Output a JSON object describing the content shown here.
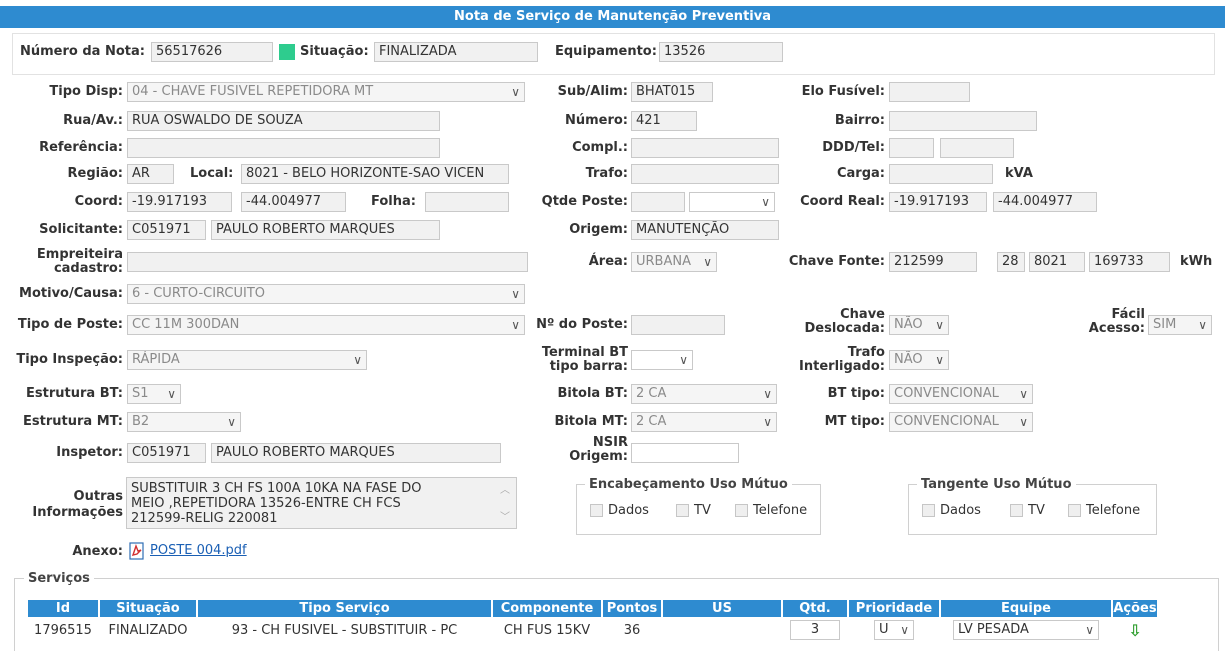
{
  "title": "Nota de Serviço de Manutenção Preventiva",
  "header": {
    "numero_label": "Número da Nota:",
    "numero_value": "56517626",
    "situacao_label": "Situação:",
    "situacao_value": "FINALIZADA",
    "status_color": "#2ecc8e",
    "equip_label": "Equipamento:",
    "equip_value": "13526"
  },
  "form": {
    "tipo_disp_label": "Tipo Disp:",
    "tipo_disp_value": "04 - CHAVE FUSIVEL REPETIDORA MT",
    "sub_alim_label": "Sub/Alim:",
    "sub_alim_value": "BHAT015",
    "elo_label": "Elo Fusível:",
    "elo_value": "",
    "rua_label": "Rua/Av.:",
    "rua_value": "RUA OSWALDO DE SOUZA",
    "numero_label": "Número:",
    "numero_value": "421",
    "bairro_label": "Bairro:",
    "bairro_value": "",
    "referencia_label": "Referência:",
    "referencia_value": "",
    "compl_label": "Compl.:",
    "compl_value": "",
    "ddd_label": "DDD/Tel:",
    "ddd_value": "",
    "tel_value": "",
    "regiao_label": "Região:",
    "regiao_value": "AR",
    "local_label": "Local:",
    "local_value": "8021 - BELO HORIZONTE-SAO VICEN",
    "trafo_label": "Trafo:",
    "trafo_value": "",
    "carga_label": "Carga:",
    "carga_value": "",
    "carga_unit": "kVA",
    "coord_label": "Coord:",
    "coord_lat": "-19.917193",
    "coord_lon": "-44.004977",
    "folha_label": "Folha:",
    "folha_value": "",
    "qtde_poste_label": "Qtde Poste:",
    "qtde_poste_value": "",
    "qtde_poste_select": "",
    "coord_real_label": "Coord Real:",
    "coord_real_lat": "-19.917193",
    "coord_real_lon": "-44.004977",
    "solicitante_label": "Solicitante:",
    "solicitante_code": "C051971",
    "solicitante_name": "PAULO ROBERTO MARQUES",
    "origem_label": "Origem:",
    "origem_value": "MANUTENÇÃO",
    "empreiteira_label_1": "Empreiteira",
    "empreiteira_label_2": "cadastro:",
    "empreiteira_value": "",
    "area_label": "Área:",
    "area_value": "URBANA",
    "chave_fonte_label": "Chave Fonte:",
    "chave_fonte_1": "212599",
    "chave_fonte_2": "28",
    "chave_fonte_3": "8021",
    "chave_fonte_4": "169733",
    "kwh_unit": "kWh",
    "motivo_label": "Motivo/Causa:",
    "motivo_value": "6 - CURTO-CIRCUITO",
    "tipo_poste_label": "Tipo de Poste:",
    "tipo_poste_value": "CC 11M 300DAN",
    "n_poste_label": "Nº do Poste:",
    "n_poste_value": "",
    "chave_desl_label_1": "Chave",
    "chave_desl_label_2": "Deslocada:",
    "chave_desl_value": "NÃO",
    "facil_label_1": "Fácil",
    "facil_label_2": "Acesso:",
    "facil_value": "SIM",
    "tipo_insp_label": "Tipo Inspeção:",
    "tipo_insp_value": "RÁPIDA",
    "terminal_label_1": "Terminal BT",
    "terminal_label_2": "tipo barra:",
    "terminal_value": "",
    "trafo_int_label_1": "Trafo",
    "trafo_int_label_2": "Interligado:",
    "trafo_int_value": "NÃO",
    "estrutura_bt_label": "Estrutura BT:",
    "estrutura_bt_value": "S1",
    "bitola_bt_label": "Bitola BT:",
    "bitola_bt_value": "2 CA",
    "bt_tipo_label": "BT tipo:",
    "bt_tipo_value": "CONVENCIONAL",
    "estrutura_mt_label": "Estrutura MT:",
    "estrutura_mt_value": "B2",
    "bitola_mt_label": "Bitola MT:",
    "bitola_mt_value": "2 CA",
    "mt_tipo_label": "MT tipo:",
    "mt_tipo_value": "CONVENCIONAL",
    "inspetor_label": "Inspetor:",
    "inspetor_code": "C051971",
    "inspetor_name": "PAULO ROBERTO MARQUES",
    "nsir_label_1": "NSIR",
    "nsir_label_2": "Origem:",
    "nsir_value": "",
    "outras_label_1": "Outras",
    "outras_label_2": "Informações",
    "outras_line_1": "SUBSTITUIR 3 CH FS 100A 10KA NA FASE DO",
    "outras_line_2": "MEIO  ,REPETIDORA 13526-ENTRE CH FCS",
    "outras_line_3": "212599-RELIG 220081",
    "anexo_label": "Anexo:",
    "anexo_file": "POSTE 004.pdf"
  },
  "enc_group": {
    "legend": "Encabeçamento Uso Mútuo",
    "dados": "Dados",
    "tv": "TV",
    "telefone": "Telefone"
  },
  "tan_group": {
    "legend": "Tangente Uso Mútuo",
    "dados": "Dados",
    "tv": "TV",
    "telefone": "Telefone"
  },
  "servicos": {
    "legend": "Serviços",
    "headers": {
      "id": "Id",
      "situacao": "Situação",
      "tipo": "Tipo Serviço",
      "componente": "Componente",
      "pontos": "Pontos",
      "us": "US",
      "qtd": "Qtd.",
      "prioridade": "Prioridade",
      "equipe": "Equipe",
      "acoes": "Ações"
    },
    "row": {
      "id": "1796515",
      "situacao": "FINALIZADO",
      "tipo": "93 - CH FUSIVEL - SUBSTITUIR - PC",
      "componente": "CH FUS 15KV",
      "pontos": "36",
      "us": "",
      "qtd": "3",
      "prioridade": "U",
      "equipe": "LV PESADA"
    }
  }
}
